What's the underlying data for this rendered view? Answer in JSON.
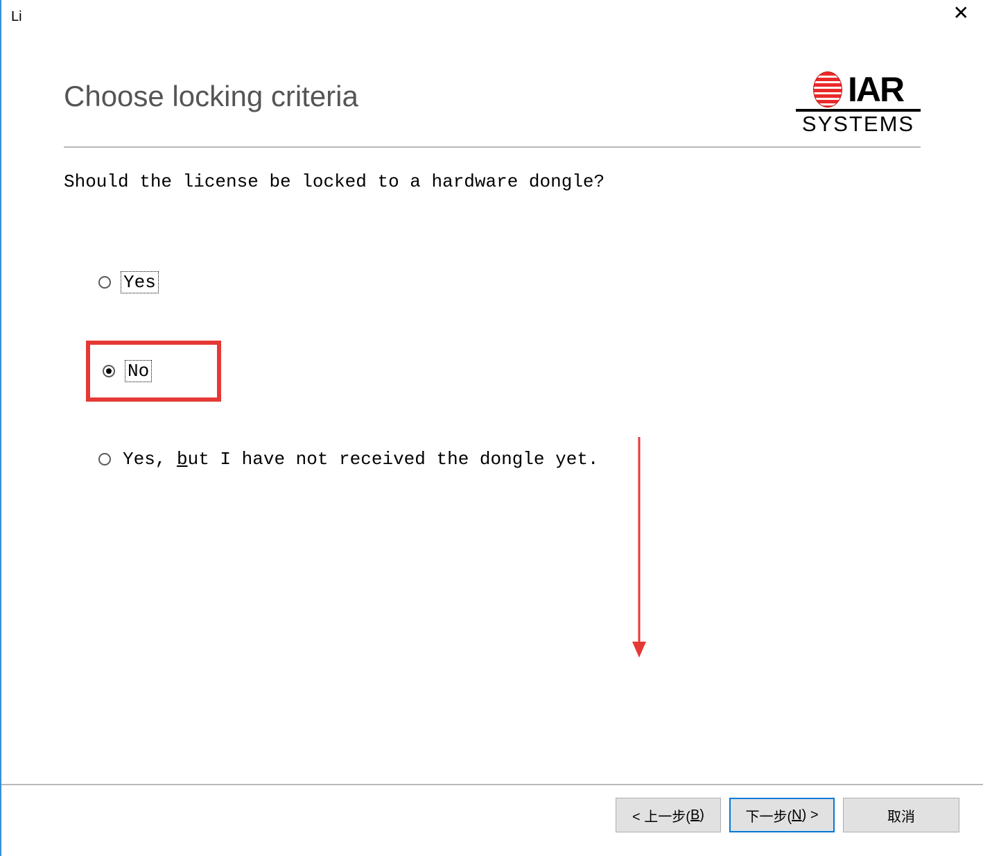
{
  "window": {
    "title": "Li"
  },
  "header": {
    "title": "Choose locking criteria"
  },
  "logo": {
    "top": "IAR",
    "bottom": "SYSTEMS"
  },
  "question": "Should the license be locked to a hardware dongle?",
  "options": {
    "yes": {
      "label": "Yes",
      "selected": false
    },
    "no": {
      "label": "No",
      "selected": true,
      "highlighted": true
    },
    "not_received": {
      "prefix": "Yes, ",
      "under_char": "b",
      "suffix": "ut I have not received the dongle yet.",
      "selected": false
    }
  },
  "buttons": {
    "back": {
      "prefix": "< 上一步(",
      "under_char": "B",
      "suffix": ")"
    },
    "next": {
      "prefix": "下一步(",
      "under_char": "N",
      "suffix": ") >"
    },
    "cancel": "取消"
  },
  "annotation": {
    "arrow_color": "#e53935",
    "highlight_color": "#e53935"
  }
}
